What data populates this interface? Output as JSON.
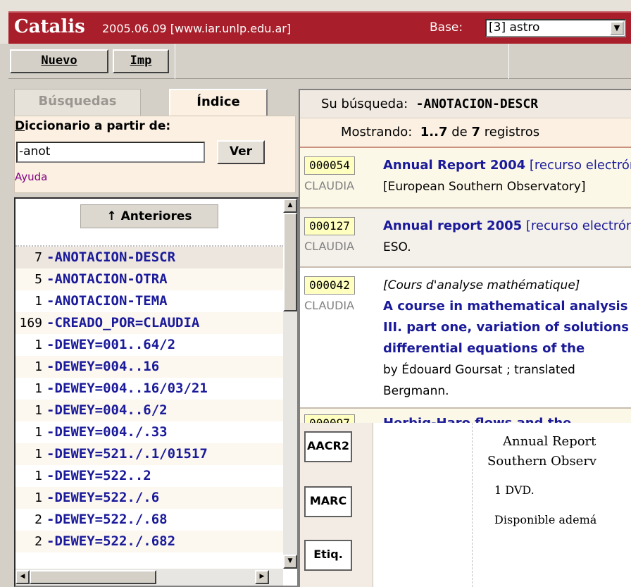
{
  "header": {
    "app_name": "Catalis",
    "version": "2005.06.09 [www.iar.unlp.edu.ar]",
    "base_label": "Base:",
    "base_value": "[3] astro"
  },
  "toolbar": {
    "new_label": "Nuevo",
    "print_label": "Imp"
  },
  "tabs": {
    "search": "Búsquedas",
    "index": "Índice"
  },
  "dictionary": {
    "label": "Diccionario a partir de:",
    "input_value": "-anot",
    "see_button": "Ver",
    "help_link": "Ayuda"
  },
  "index_list": {
    "previous_button": "↑ Anteriores",
    "items": [
      {
        "count": "7",
        "term": "-ANOTACION-DESCR"
      },
      {
        "count": "5",
        "term": "-ANOTACION-OTRA"
      },
      {
        "count": "1",
        "term": "-ANOTACION-TEMA"
      },
      {
        "count": "169",
        "term": "-CREADO_POR=CLAUDIA"
      },
      {
        "count": "1",
        "term": "-DEWEY=001..64/2"
      },
      {
        "count": "1",
        "term": "-DEWEY=004..16"
      },
      {
        "count": "1",
        "term": "-DEWEY=004..16/03/21"
      },
      {
        "count": "1",
        "term": "-DEWEY=004..6/2"
      },
      {
        "count": "1",
        "term": "-DEWEY=004./.33"
      },
      {
        "count": "1",
        "term": "-DEWEY=521./.1/01517"
      },
      {
        "count": "1",
        "term": "-DEWEY=522..2"
      },
      {
        "count": "1",
        "term": "-DEWEY=522./.6"
      },
      {
        "count": "2",
        "term": "-DEWEY=522./.68"
      },
      {
        "count": "2",
        "term": "-DEWEY=522./.682"
      }
    ]
  },
  "results": {
    "query_label": "Su búsqueda:",
    "query_value": "-ANOTACION-DESCR",
    "showing_label": "Mostrando:",
    "showing_range": "1..7",
    "showing_of": "de",
    "showing_total": "7",
    "showing_suffix": "registros",
    "records": [
      {
        "id": "000054",
        "user": "CLAUDIA",
        "title": "Annual Report 2004",
        "title_rest": " [recurso electrónico]",
        "line2": "[European Southern Observatory]"
      },
      {
        "id": "000127",
        "user": "CLAUDIA",
        "title": "Annual report 2005",
        "title_rest": " [recurso electrónico]",
        "line2": "ESO."
      },
      {
        "id": "000042",
        "user": "CLAUDIA",
        "italic": "[Cours d'analyse mathématique]",
        "title_lines": [
          "A course in mathematical analysis",
          "III. part one, variation of solutions",
          "differential equations of the"
        ],
        "line3": "by Édouard Goursat ; translated",
        "line4": "Bergmann."
      },
      {
        "id": "000097",
        "user": "",
        "title": "Herbig-Haro flows and the"
      }
    ]
  },
  "formats": {
    "aacr2": "AACR2",
    "marc": "MARC",
    "label": "Etiq."
  },
  "preview": {
    "line1": "Annual Report",
    "line2": "Southern Observ",
    "line3": "1 DVD.",
    "line4": "Disponible ademá"
  }
}
